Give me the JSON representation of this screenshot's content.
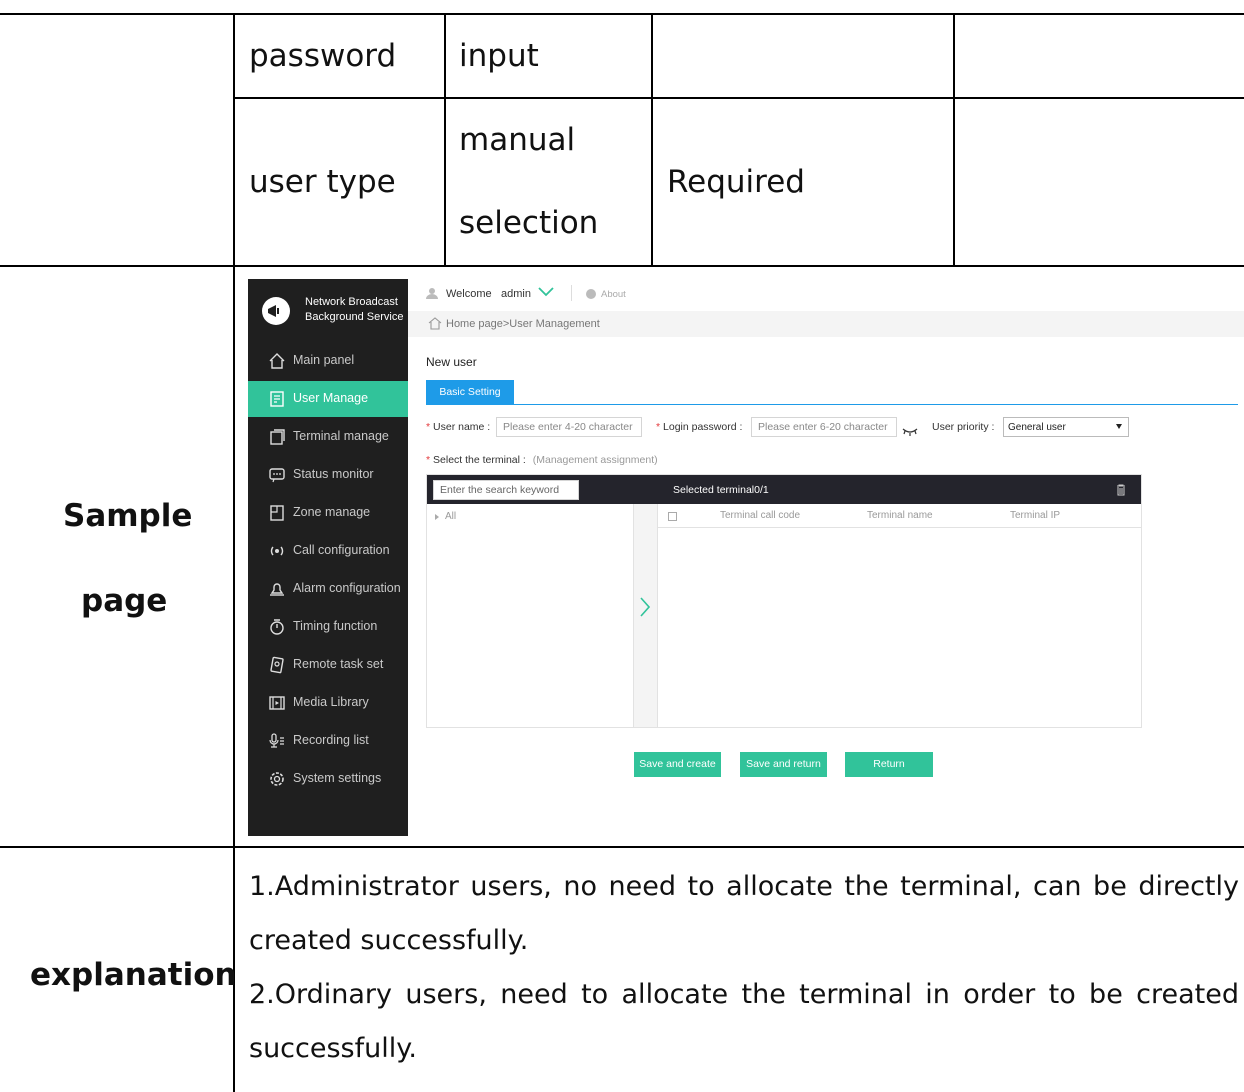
{
  "table": {
    "rows": [
      {
        "field": "password",
        "type": "input",
        "required": "",
        "note": ""
      },
      {
        "field": "user type",
        "type_line1": "manual",
        "type_line2": "selection",
        "required": "Required",
        "note": ""
      }
    ],
    "sample_label_line1": "Sample",
    "sample_label_line2": "page",
    "explanation_label": "explanation",
    "explanation_1_line1": "1.Administrator users, no need to allocate the terminal, can be directly",
    "explanation_1_line2": "created successfully.",
    "explanation_2_line1": "2.Ordinary users, need to allocate the terminal in order to be created",
    "explanation_2_line2": "successfully."
  },
  "app": {
    "brand": {
      "line1": "Network Broadcast",
      "line2": "Background Service",
      "icon": "megaphone-icon"
    },
    "sidebar": {
      "items": [
        {
          "label": "Main panel",
          "icon": "home-icon",
          "active": false
        },
        {
          "label": "User Manage",
          "icon": "user-manage-icon",
          "active": true
        },
        {
          "label": "Terminal manage",
          "icon": "terminal-icon",
          "active": false
        },
        {
          "label": "Status monitor",
          "icon": "monitor-icon",
          "active": false
        },
        {
          "label": "Zone manage",
          "icon": "zone-icon",
          "active": false
        },
        {
          "label": "Call configuration",
          "icon": "broadcast-icon",
          "active": false
        },
        {
          "label": "Alarm configuration",
          "icon": "bell-icon",
          "active": false
        },
        {
          "label": "Timing function",
          "icon": "timer-icon",
          "active": false
        },
        {
          "label": "Remote task set",
          "icon": "remote-icon",
          "active": false
        },
        {
          "label": "Media Library",
          "icon": "media-icon",
          "active": false
        },
        {
          "label": "Recording list",
          "icon": "microphone-icon",
          "active": false
        },
        {
          "label": "System settings",
          "icon": "gear-icon",
          "active": false
        }
      ]
    },
    "topbar": {
      "welcome": "Welcome",
      "username": "admin",
      "about": "About"
    },
    "breadcrumb": "Home page>User Management",
    "page_title": "New user",
    "tab": "Basic Setting",
    "form": {
      "username_label": "User name :",
      "username_placeholder": "Please enter 4-20 character",
      "password_label": "Login password :",
      "password_placeholder": "Please enter 6-20 character",
      "priority_label": "User priority :",
      "priority_value": "General user",
      "terminal_label": "Select the terminal :",
      "terminal_hint": "(Management assignment)"
    },
    "terminal_panel": {
      "search_placeholder": "Enter the search keyword",
      "selected_label": "Selected terminal0/1",
      "tree_root": "All",
      "columns": [
        "Terminal call code",
        "Terminal name",
        "Terminal IP"
      ]
    },
    "buttons": {
      "save_create": "Save and create",
      "save_return": "Save and return",
      "return": "Return"
    },
    "accent_color": "#31c39a",
    "tab_color": "#1e9be8"
  }
}
